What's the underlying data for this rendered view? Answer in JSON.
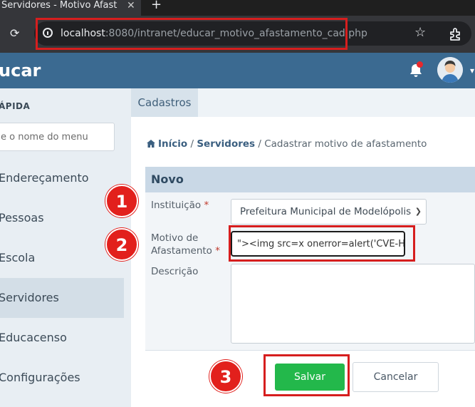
{
  "browser": {
    "tab_title": "Servidores - Motivo Afast",
    "tab_close": "✕",
    "new_tab": "+",
    "url_host": "localhost",
    "url_rest": ":8080/intranet/educar_motivo_afastamento_cad.php"
  },
  "app": {
    "brand": "ucar",
    "colors": {
      "header": "#3b6a91",
      "accent_red": "#e2201c",
      "save_green": "#23b84b"
    }
  },
  "sidebar": {
    "quick_title": "ÁPIDA",
    "search_placeholder": "e o nome do menu",
    "items": [
      {
        "label": "Endereçamento"
      },
      {
        "label": "Pessoas"
      },
      {
        "label": "Escola"
      },
      {
        "label": "Servidores",
        "active": true
      },
      {
        "label": "Educacenso"
      },
      {
        "label": "Configurações"
      }
    ]
  },
  "content": {
    "subtab": "Cadastros",
    "breadcrumb": {
      "home": "Início",
      "sep1": " / ",
      "section": "Servidores",
      "sep2": " / ",
      "current": "Cadastrar motivo de afastamento"
    },
    "panel_title": "Novo",
    "form": {
      "instituicao_label": "Instituição",
      "instituicao_value": "Prefeitura Municipal de Modelópolis",
      "motivo_label_1": "Motivo de",
      "motivo_label_2": "Afastamento",
      "motivo_value": "\"><img src=x onerror=alert('CVE-Hu",
      "descricao_label": "Descrição",
      "required_mark": "*"
    },
    "buttons": {
      "save": "Salvar",
      "cancel": "Cancelar"
    }
  },
  "annotations": {
    "badge_1": "1",
    "badge_2": "2",
    "badge_3": "3"
  }
}
